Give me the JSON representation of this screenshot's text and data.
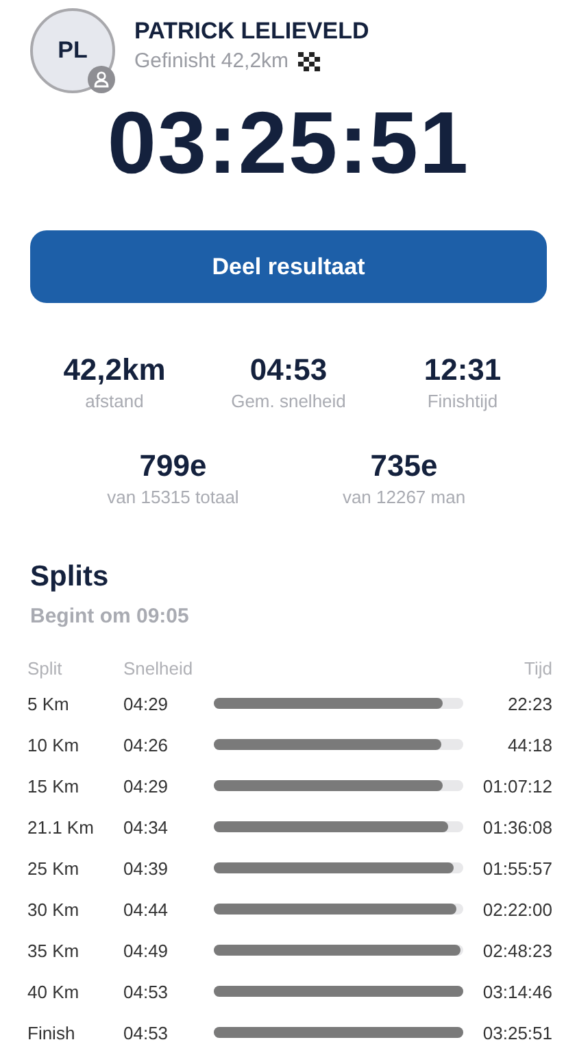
{
  "profile": {
    "initials": "PL",
    "name": "PATRICK LELIEVELD",
    "subtitle": "Gefinisht 42,2km"
  },
  "finish_time": "03:25:51",
  "share_button": "Deel resultaat",
  "stats": [
    {
      "value": "42,2km",
      "label": "afstand"
    },
    {
      "value": "04:53",
      "label": "Gem. snelheid"
    },
    {
      "value": "12:31",
      "label": "Finishtijd"
    }
  ],
  "ranks": [
    {
      "value": "799e",
      "label": "van 15315 totaal"
    },
    {
      "value": "735e",
      "label": "van 12267 man"
    }
  ],
  "splits": {
    "title": "Splits",
    "start": "Begint om 09:05",
    "columns": [
      "Split",
      "Snelheid",
      "Tijd"
    ],
    "rows": [
      {
        "split": "5 Km",
        "pace": "04:29",
        "level": 0.92,
        "time": "22:23"
      },
      {
        "split": "10 Km",
        "pace": "04:26",
        "level": 0.91,
        "time": "44:18"
      },
      {
        "split": "15 Km",
        "pace": "04:29",
        "level": 0.92,
        "time": "01:07:12"
      },
      {
        "split": "21.1 Km",
        "pace": "04:34",
        "level": 0.94,
        "time": "01:36:08"
      },
      {
        "split": "25 Km",
        "pace": "04:39",
        "level": 0.96,
        "time": "01:55:57"
      },
      {
        "split": "30 Km",
        "pace": "04:44",
        "level": 0.97,
        "time": "02:22:00"
      },
      {
        "split": "35 Km",
        "pace": "04:49",
        "level": 0.99,
        "time": "02:48:23"
      },
      {
        "split": "40 Km",
        "pace": "04:53",
        "level": 1,
        "time": "03:14:46"
      },
      {
        "split": "Finish",
        "pace": "04:53",
        "level": 1,
        "time": "03:25:51"
      }
    ]
  }
}
